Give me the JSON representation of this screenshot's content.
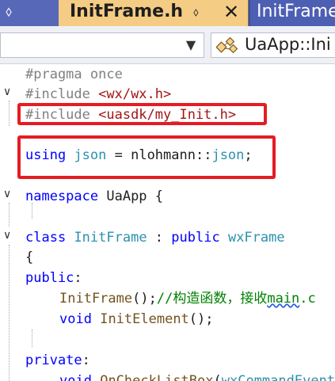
{
  "tabs": {
    "pin_glyph": "⬨",
    "active_title": "InitFrame.h",
    "active_pin_glyph": "⬨",
    "active_close_glyph": "✕",
    "inactive_title": "InitFrame"
  },
  "navbar": {
    "left_dropdown_arrow": "▼",
    "scope_icon": "class-members-icon",
    "scope_text": "UaApp::Ini"
  },
  "code": {
    "l1": "#pragma once",
    "l2_kw": "#include ",
    "l2_path": "<wx/wx.h>",
    "l3_kw": "#include ",
    "l3_path": "<uasdk/my_Init.h>",
    "l4_kw": "using",
    "l4_alias": "json",
    "l4_eq": " = nlohmann::",
    "l4_type": "json",
    "l4_end": ";",
    "l5_kw": "namespace",
    "l5_rest": " UaApp {",
    "l6_kw": "class",
    "l6_name": "InitFrame",
    "l6_colon": " : ",
    "l6_pub": "public",
    "l6_base": "wxFrame",
    "l7": "{",
    "l8_kw": "public",
    "l8_colon": ":",
    "l9_fn": "InitFrame",
    "l9_paren": "();",
    "l9_comment": "//构造函数，接收",
    "l9_comment_sq": "main",
    "l9_comment_end": ".c",
    "l10_kw": "void",
    "l10_fn": "InitElement",
    "l10_end": "();",
    "l11_kw": "private",
    "l11_colon": ":",
    "l12_kw": "void",
    "l12_fn": "OnCheckListBox",
    "l12_paren": "(",
    "l12_type": "wxCommandEvent"
  },
  "fold_glyph": "∨"
}
